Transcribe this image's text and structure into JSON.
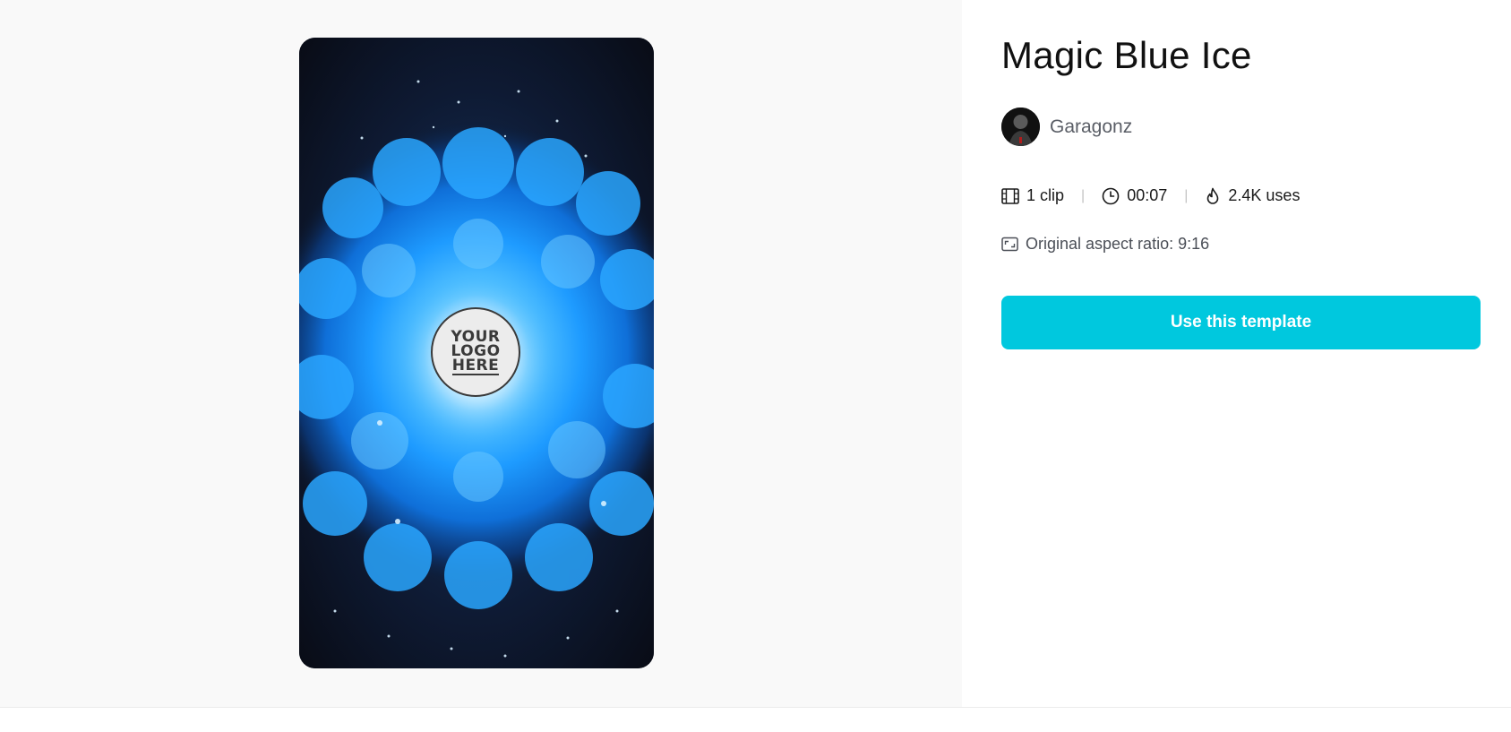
{
  "template": {
    "title": "Magic Blue Ice",
    "author": {
      "name": "Garagonz"
    },
    "stats": {
      "clips": "1 clip",
      "duration": "00:07",
      "uses": "2.4K uses"
    },
    "aspect_ratio": "Original aspect ratio: 9:16"
  },
  "preview": {
    "logo_placeholder": [
      "YOUR",
      "LOGO",
      "HERE"
    ]
  },
  "actions": {
    "use_template_label": "Use this template"
  },
  "icons": {
    "clips": "film-icon",
    "duration": "clock-icon",
    "uses": "flame-icon",
    "aspect": "aspect-ratio-icon"
  },
  "colors": {
    "accent": "#00c8de",
    "preview_background": "#f9f9f9",
    "title": "#111111",
    "secondary_text": "#5a5e66",
    "ice_blue": "#1e9bff"
  }
}
